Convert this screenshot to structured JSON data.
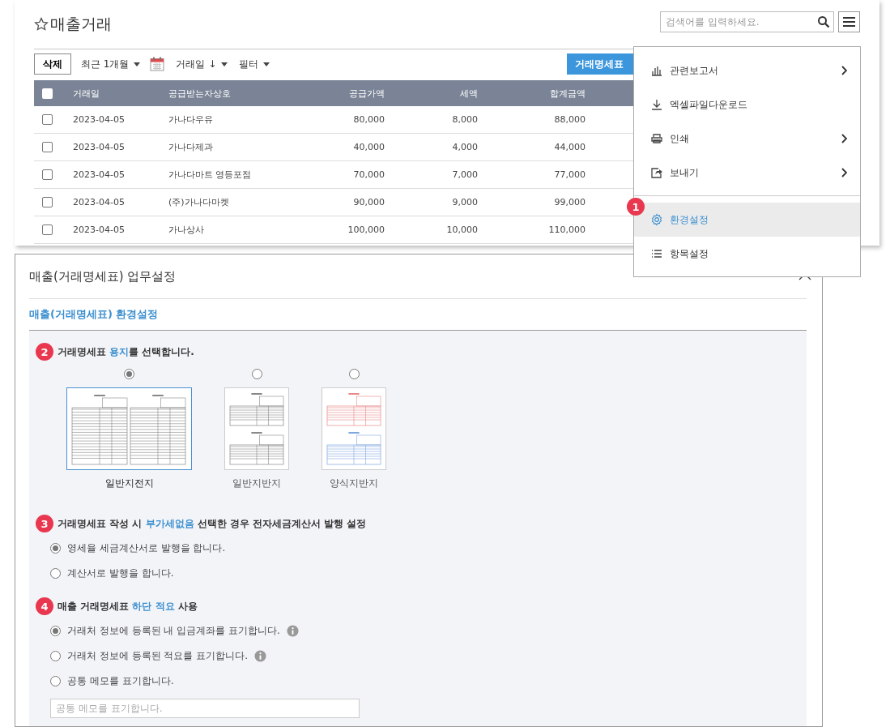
{
  "page": {
    "title": "매출거래",
    "favorite": false
  },
  "search": {
    "placeholder": "검색어를 입력하세요."
  },
  "toolbar": {
    "delete_button": "삭제",
    "period": "최근 1개월",
    "sort": "거래일 ↓",
    "filter": "필터",
    "statement_button": "거래명세표"
  },
  "table": {
    "all_checked": false,
    "columns": [
      "거래일",
      "공급받는자상호",
      "공급가액",
      "세액",
      "합계금액"
    ],
    "rows": [
      {
        "checked": false,
        "cells": [
          "2023-04-05",
          "가나다우유",
          "80,000",
          "8,000",
          "88,000"
        ]
      },
      {
        "checked": false,
        "cells": [
          "2023-04-05",
          "가나다제과",
          "40,000",
          "4,000",
          "44,000"
        ]
      },
      {
        "checked": false,
        "cells": [
          "2023-04-05",
          "가나다마트 영등포점",
          "70,000",
          "7,000",
          "77,000"
        ]
      },
      {
        "checked": false,
        "cells": [
          "2023-04-05",
          "(주)가나다마켓",
          "90,000",
          "9,000",
          "99,000"
        ]
      },
      {
        "checked": false,
        "cells": [
          "2023-04-05",
          "가나상사",
          "100,000",
          "10,000",
          "110,000"
        ]
      }
    ]
  },
  "menu": {
    "groups": [
      [
        {
          "label": "관련보고서",
          "submenu": true,
          "selected": false
        },
        {
          "label": "엑셀파일다운로드",
          "submenu": false,
          "selected": false
        },
        {
          "label": "인쇄",
          "submenu": true,
          "selected": false
        },
        {
          "label": "보내기",
          "submenu": true,
          "selected": false
        }
      ],
      [
        {
          "label": "환경설정",
          "submenu": false,
          "selected": true,
          "badge": "1"
        },
        {
          "label": "항목설정",
          "submenu": false,
          "selected": false
        }
      ]
    ]
  },
  "settings": {
    "title": "매출(거래명세표) 업무설정",
    "subtitle": "매출(거래명세표) 환경설정",
    "sections": [
      {
        "kind": "paper",
        "badge": "2",
        "heading": {
          "before": "거래명세표 ",
          "highlight": "용지",
          "after": "를 선택합니다."
        },
        "papers": [
          {
            "kind": "full",
            "label": "일반지전지",
            "selected": true
          },
          {
            "kind": "half",
            "label": "일반지반지",
            "selected": false
          },
          {
            "kind": "color-half",
            "label": "양식지반지",
            "selected": false
          }
        ]
      },
      {
        "kind": "options",
        "badge": "3",
        "heading": {
          "before": "거래명세표 작성 시 ",
          "highlight": "부가세없음",
          "after": " 선택한 경우 전자세금계산서 발행 설정"
        },
        "options": [
          {
            "label": "영세율 세금계산서로 발행을 합니다.",
            "selected": true,
            "info": false
          },
          {
            "label": "계산서로 발행을 합니다.",
            "selected": false,
            "info": false
          }
        ]
      },
      {
        "kind": "options",
        "badge": "4",
        "heading": {
          "before": "매출 거래명세표 ",
          "highlight": "하단 적요",
          "after": " 사용"
        },
        "options": [
          {
            "label": "거래처 정보에 등록된 내 입금계좌를 표기합니다.",
            "selected": true,
            "info": true
          },
          {
            "label": "거래처 정보에 등록된 적요를 표기합니다.",
            "selected": false,
            "info": true
          },
          {
            "label": "공통 메모를 표기합니다.",
            "selected": false,
            "info": false
          }
        ],
        "memo": {
          "placeholder": "공통 메모를 표기합니다."
        }
      }
    ]
  }
}
